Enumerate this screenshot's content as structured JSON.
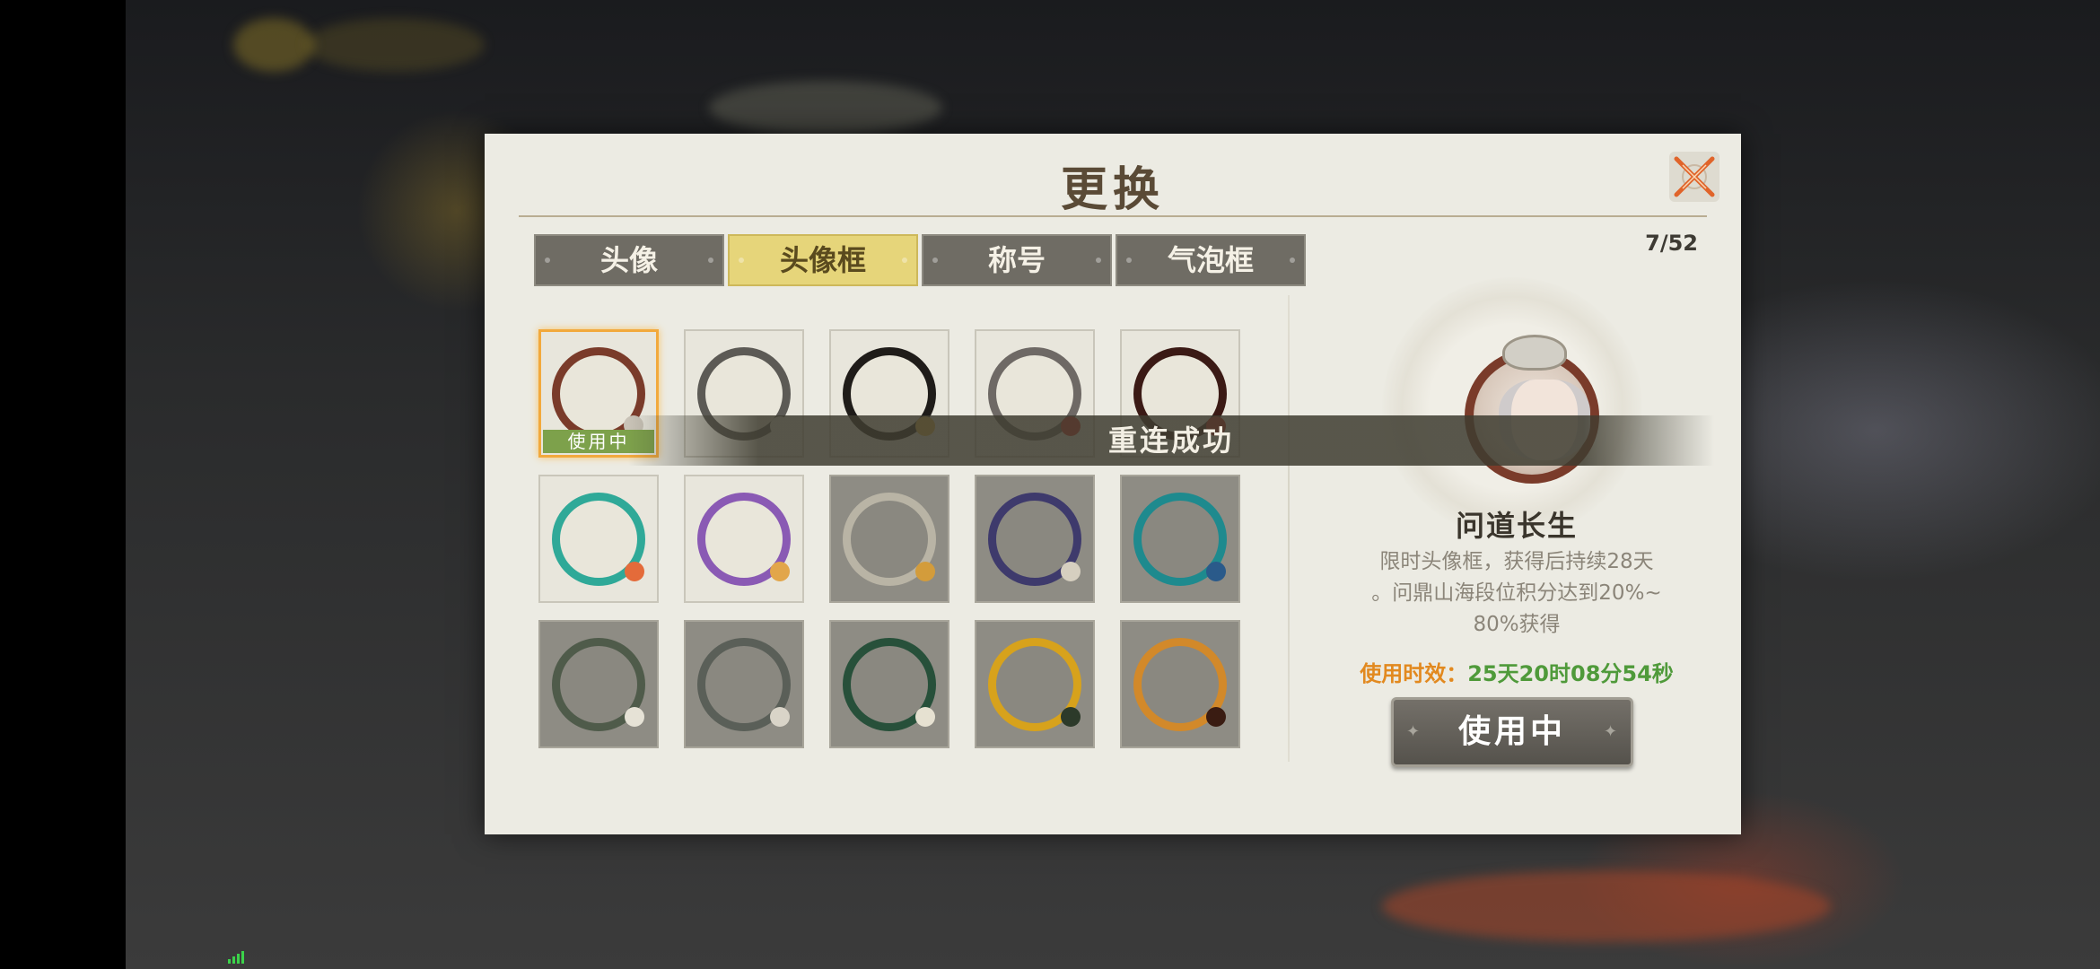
{
  "dialog": {
    "title": "更换",
    "counter": "7/52",
    "close_icon": "close-x-icon"
  },
  "tabs": [
    {
      "label": "头像",
      "active": false
    },
    {
      "label": "头像框",
      "active": true
    },
    {
      "label": "称号",
      "active": false
    },
    {
      "label": "气泡框",
      "active": false
    }
  ],
  "frames": [
    {
      "tone": "light",
      "ring": "#7a3b2a",
      "accent": "#c9c3b7",
      "selected": true,
      "tag": "使用中"
    },
    {
      "tone": "light",
      "ring": "#5c5a55",
      "accent": "#e8e6dc",
      "selected": false
    },
    {
      "tone": "light",
      "ring": "#1f1c19",
      "accent": "#e3b64a",
      "selected": false
    },
    {
      "tone": "light",
      "ring": "#6e6965",
      "accent": "#d2322a",
      "selected": false
    },
    {
      "tone": "light",
      "ring": "#3b1a15",
      "accent": "#c2251c",
      "selected": false
    },
    {
      "tone": "light",
      "ring": "#2fa998",
      "accent": "#e46b3a",
      "selected": false
    },
    {
      "tone": "light",
      "ring": "#8a5ab4",
      "accent": "#e2a64a",
      "selected": false
    },
    {
      "tone": "dark",
      "ring": "#b9b4a5",
      "accent": "#d39c3b",
      "selected": false
    },
    {
      "tone": "dark",
      "ring": "#3e3a6c",
      "accent": "#d6cfc0",
      "selected": false
    },
    {
      "tone": "dark",
      "ring": "#1e8a8e",
      "accent": "#2a5a8a",
      "selected": false
    },
    {
      "tone": "dark",
      "ring": "#4f5b4a",
      "accent": "#e6e2d6",
      "selected": false
    },
    {
      "tone": "dark",
      "ring": "#5a5f58",
      "accent": "#d9d4c8",
      "selected": false
    },
    {
      "tone": "dark",
      "ring": "#27503a",
      "accent": "#e6e1d1",
      "selected": false
    },
    {
      "tone": "dark",
      "ring": "#d7a21c",
      "accent": "#2c3a2a",
      "selected": false
    },
    {
      "tone": "dark",
      "ring": "#d2892a",
      "accent": "#3a1c12",
      "selected": false
    }
  ],
  "detail": {
    "name": "问道长生",
    "desc_line1": "限时头像框，获得后持续28天",
    "desc_line2": "。问鼎山海段位积分达到20%~",
    "desc_line3": "80%获得",
    "duration_label": "使用时效：",
    "duration_value": "25天20时08分54秒",
    "button_label": "使用中"
  },
  "toast": "重连成功"
}
